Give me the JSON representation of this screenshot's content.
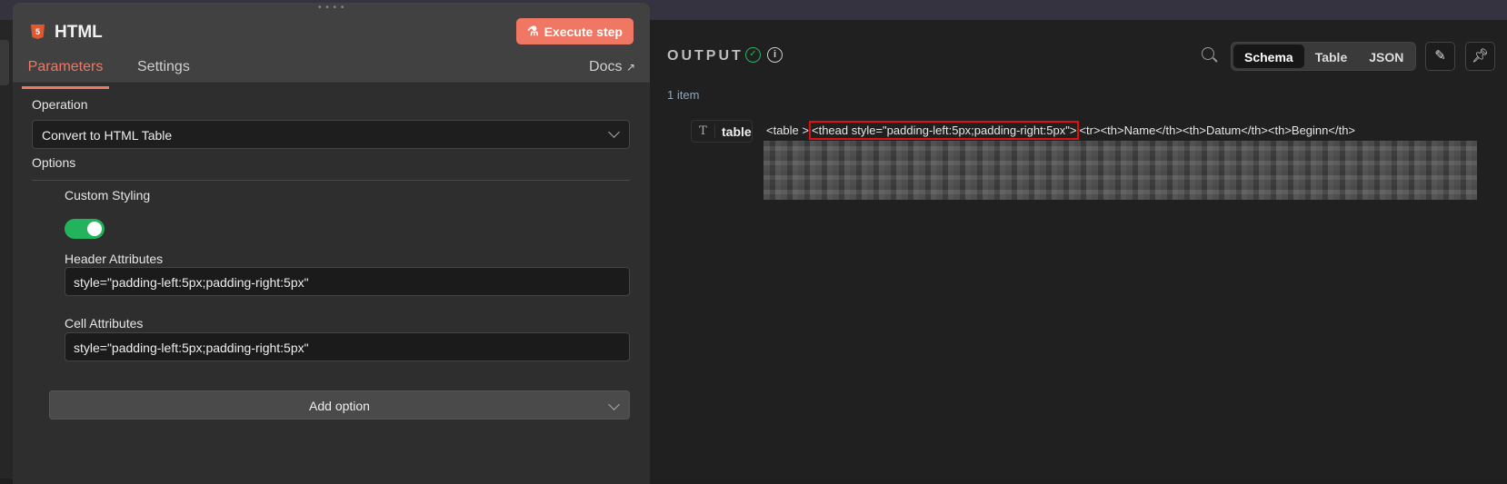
{
  "node": {
    "title": "HTML",
    "execute_label": "Execute step",
    "tabs": [
      "Parameters",
      "Settings"
    ],
    "docs_label": "Docs"
  },
  "params": {
    "operation_label": "Operation",
    "operation_value": "Convert to HTML Table",
    "options_label": "Options",
    "custom_styling_label": "Custom Styling",
    "custom_styling_on": true,
    "header_attr_label": "Header Attributes",
    "header_attr_value": "style=\"padding-left:5px;padding-right:5px\"",
    "cell_attr_label": "Cell Attributes",
    "cell_attr_value": "style=\"padding-left:5px;padding-right:5px\"",
    "add_option_label": "Add option"
  },
  "output": {
    "title": "OUTPUT",
    "views": [
      "Schema",
      "Table",
      "JSON"
    ],
    "active_view": "Schema",
    "item_count": "1 item",
    "field_type_icon": "T",
    "field_name": "table",
    "code_pre": "<table >",
    "code_highlight": "<thead style=\"padding-left:5px;padding-right:5px\">",
    "code_post": "<tr><th>Name</th><th>Datum</th><th>Beginn</th>"
  },
  "colors": {
    "accent": "#f07763",
    "success": "#23b35c",
    "highlight": "#e01010"
  }
}
